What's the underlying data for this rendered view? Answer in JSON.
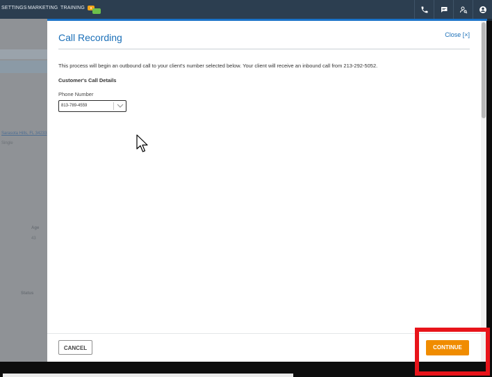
{
  "topbar": {
    "nav": [
      "SETTINGS",
      "MARKETING",
      "TRAINING"
    ],
    "icons": [
      "phone-icon",
      "chat-icon",
      "user-search-icon",
      "account-icon"
    ]
  },
  "background_page": {
    "labels": [
      "Age",
      "43",
      "Status",
      "Sarasota Hills, FL 34233",
      "Single"
    ]
  },
  "modal": {
    "title": "Call Recording",
    "close_label": "Close [×]",
    "intro": "This process will begin an outbound call to your client's number selected below. Your client will receive an inbound call from 213-292-5052.",
    "section_heading": "Customer's Call Details",
    "phone_label": "Phone Number",
    "phone_value": "813-789-4559",
    "cancel_label": "CANCEL",
    "continue_label": "CONTINUE"
  },
  "colors": {
    "accent_blue": "#1a6fb8",
    "continue_orange": "#f08c00",
    "highlight_red": "#e8141a",
    "nav_bg": "#2c3e50"
  }
}
